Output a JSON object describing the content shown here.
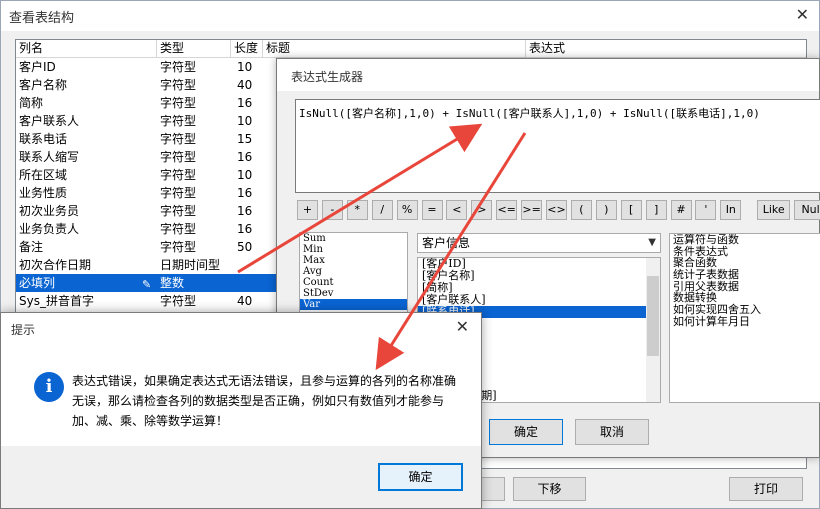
{
  "main_window": {
    "title": "查看表结构",
    "close_glyph": "✕",
    "headers": [
      "列名",
      "类型",
      "长度",
      "标题",
      "表达式"
    ],
    "rows": [
      {
        "name": "客户ID",
        "type": "字符型",
        "length": "10",
        "selected": false
      },
      {
        "name": "客户名称",
        "type": "字符型",
        "length": "40",
        "selected": false
      },
      {
        "name": "简称",
        "type": "字符型",
        "length": "16",
        "selected": false
      },
      {
        "name": "客户联系人",
        "type": "字符型",
        "length": "10",
        "selected": false
      },
      {
        "name": "联系电话",
        "type": "字符型",
        "length": "15",
        "selected": false
      },
      {
        "name": "联系人缩写",
        "type": "字符型",
        "length": "16",
        "selected": false
      },
      {
        "name": "所在区域",
        "type": "字符型",
        "length": "10",
        "selected": false
      },
      {
        "name": "业务性质",
        "type": "字符型",
        "length": "16",
        "selected": false
      },
      {
        "name": "初次业务员",
        "type": "字符型",
        "length": "16",
        "selected": false
      },
      {
        "name": "业务负责人",
        "type": "字符型",
        "length": "16",
        "selected": false
      },
      {
        "name": "备注",
        "type": "字符型",
        "length": "50",
        "selected": false
      },
      {
        "name": "初次合作日期",
        "type": "日期时间型",
        "length": "",
        "selected": false
      },
      {
        "name": "必填列",
        "type": "整数",
        "length": "",
        "selected": true
      },
      {
        "name": "Sys_拼音首字",
        "type": "字符型",
        "length": "40",
        "selected": false
      }
    ],
    "buttons": {
      "move_down": "下移",
      "print": "打印"
    }
  },
  "expression_builder": {
    "title": "表达式生成器",
    "expression": "IsNull([客户名称],1,0) + IsNull([客户联系人],1,0) + IsNull([联系电话],1,0)",
    "operators": [
      "+",
      "-",
      "*",
      "/",
      "%",
      "=",
      "<",
      ">",
      "<=",
      ">=",
      "<>",
      "(",
      ")",
      "[",
      "]",
      "#",
      "'",
      "In",
      "Like",
      "Nul"
    ],
    "functions": [
      "Sum",
      "Min",
      "Max",
      "Avg",
      "Count",
      "StDev",
      "Var"
    ],
    "table_select": "客户信息",
    "fields": [
      "[客户ID]",
      "[客户名称]",
      "[简称]",
      "[客户联系人]",
      "[联系电话]",
      "[所在区域]",
      "",
      "",
      "[业务员]",
      "[负责人]",
      "",
      "[初次合作日期]"
    ],
    "field_selected_index": 4,
    "categories": [
      "运算符与函数",
      "条件表达式",
      "聚合函数",
      "统计子表数据",
      "引用父表数据",
      "数据转换",
      "如何实现四舍五入",
      "如何计算年月日"
    ],
    "ok": "确定",
    "cancel": "取消"
  },
  "message_box": {
    "title": "提示",
    "close_glyph": "✕",
    "icon": "info-icon",
    "icon_glyph": "i",
    "message": "表达式错误，如果确定表达式无语法错误，且参与运算的各列的名称准确无误，那么请检查各列的数据类型是否正确，例如只有数值列才能参与加、减、乘、除等数学运算！",
    "ok": "确定"
  },
  "annotation_color": "#e8463a"
}
